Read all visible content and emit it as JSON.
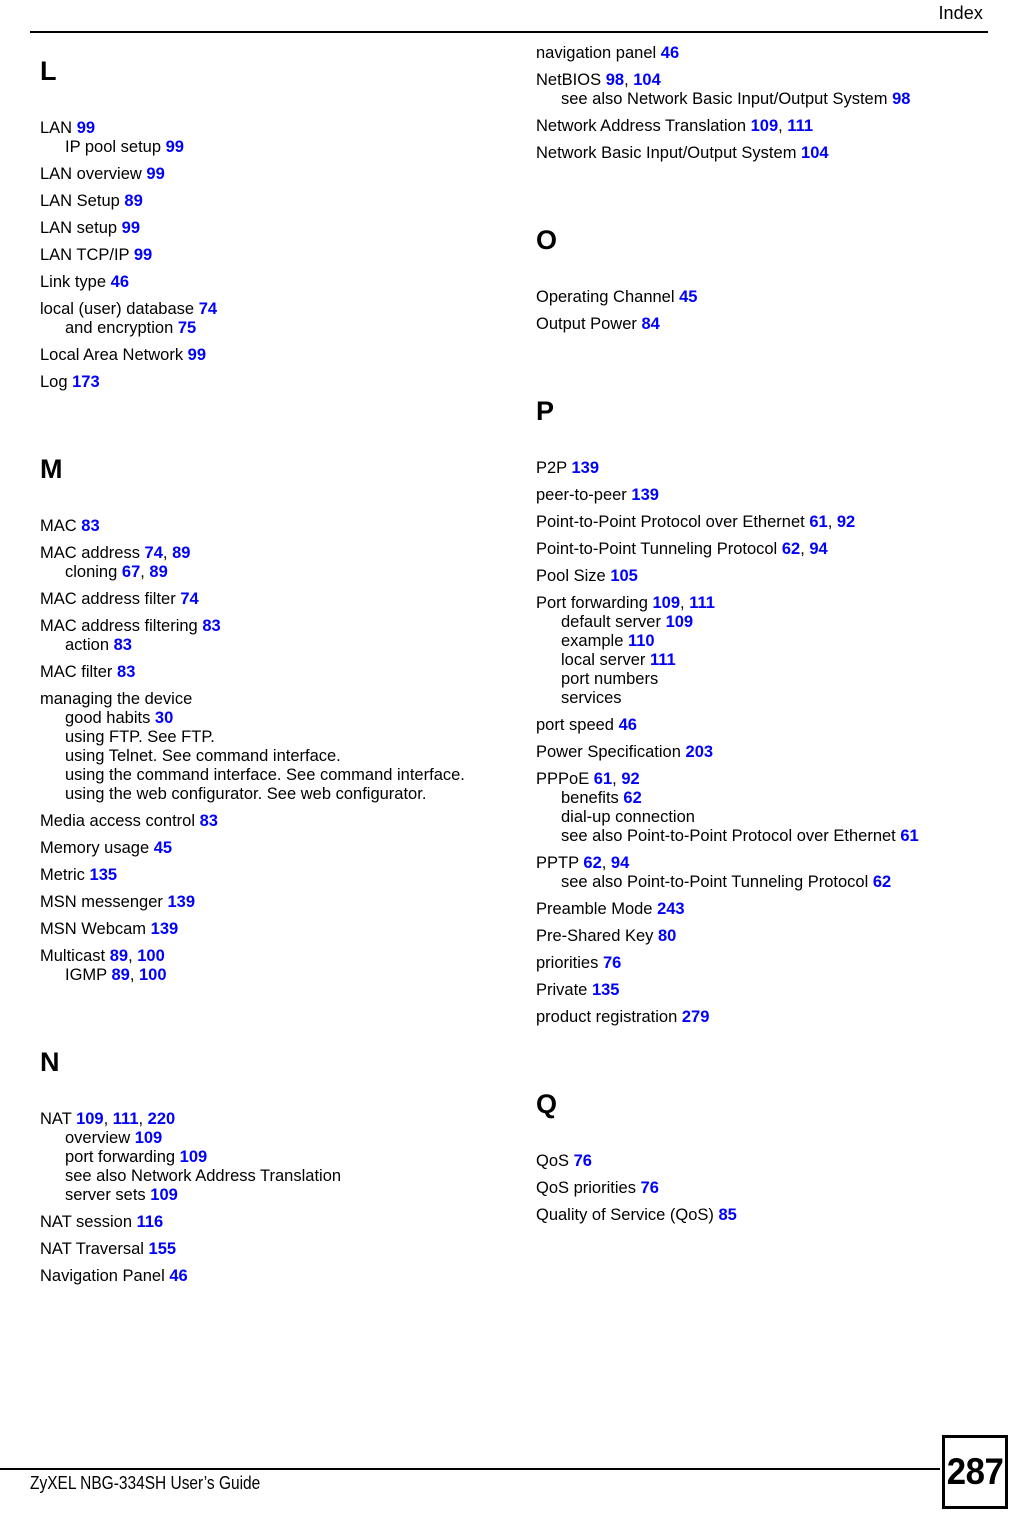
{
  "header": {
    "title": "Index"
  },
  "footer": {
    "guide_title": "ZyXEL NBG-334SH User’s Guide",
    "page_number": "287"
  },
  "colors": {
    "page_ref": "#0000ff",
    "text": "#000000",
    "background": "#ffffff"
  },
  "columns": {
    "left": {
      "sections": [
        {
          "letter": "L",
          "entries": [
            {
              "text": "LAN",
              "pages": [
                "99"
              ],
              "level": 0
            },
            {
              "text": "IP pool setup",
              "pages": [
                "99"
              ],
              "level": 1
            },
            {
              "text": "LAN overview",
              "pages": [
                "99"
              ],
              "level": 0
            },
            {
              "text": "LAN Setup",
              "pages": [
                "89"
              ],
              "level": 0
            },
            {
              "text": "LAN setup",
              "pages": [
                "99"
              ],
              "level": 0
            },
            {
              "text": "LAN TCP/IP",
              "pages": [
                "99"
              ],
              "level": 0
            },
            {
              "text": "Link type",
              "pages": [
                "46"
              ],
              "level": 0
            },
            {
              "text": "local (user) database",
              "pages": [
                "74"
              ],
              "level": 0
            },
            {
              "text": "and encryption",
              "pages": [
                "75"
              ],
              "level": 1
            },
            {
              "text": "Local Area Network",
              "pages": [
                "99"
              ],
              "level": 0
            },
            {
              "text": "Log",
              "pages": [
                "173"
              ],
              "level": 0
            }
          ]
        },
        {
          "letter": "M",
          "entries": [
            {
              "text": "MAC",
              "pages": [
                "83"
              ],
              "level": 0
            },
            {
              "text": "MAC address",
              "pages": [
                "74",
                "89"
              ],
              "level": 0
            },
            {
              "text": "cloning",
              "pages": [
                "67",
                "89"
              ],
              "level": 1
            },
            {
              "text": "MAC address filter",
              "pages": [
                "74"
              ],
              "level": 0
            },
            {
              "text": "MAC address filtering",
              "pages": [
                "83"
              ],
              "level": 0
            },
            {
              "text": "action",
              "pages": [
                "83"
              ],
              "level": 1
            },
            {
              "text": "MAC filter",
              "pages": [
                "83"
              ],
              "level": 0
            },
            {
              "text": "managing the device",
              "pages": [],
              "level": 0
            },
            {
              "text": "good habits",
              "pages": [
                "30"
              ],
              "level": 1
            },
            {
              "text": "using FTP. See FTP.",
              "pages": [],
              "level": 1
            },
            {
              "text": "using Telnet. See command interface.",
              "pages": [],
              "level": 1
            },
            {
              "text": "using the command interface. See command interface.",
              "pages": [],
              "level": 1,
              "wrap": true
            },
            {
              "text": "using the web configurator. See web configurator.",
              "pages": [],
              "level": 1
            },
            {
              "text": "Media access control",
              "pages": [
                "83"
              ],
              "level": 0
            },
            {
              "text": "Memory usage",
              "pages": [
                "45"
              ],
              "level": 0
            },
            {
              "text": "Metric",
              "pages": [
                "135"
              ],
              "level": 0
            },
            {
              "text": "MSN messenger",
              "pages": [
                "139"
              ],
              "level": 0
            },
            {
              "text": "MSN Webcam",
              "pages": [
                "139"
              ],
              "level": 0
            },
            {
              "text": "Multicast",
              "pages": [
                "89",
                "100"
              ],
              "level": 0
            },
            {
              "text": "IGMP",
              "pages": [
                "89",
                "100"
              ],
              "level": 1
            }
          ]
        },
        {
          "letter": "N",
          "entries": [
            {
              "text": "NAT",
              "pages": [
                "109",
                "111",
                "220"
              ],
              "level": 0
            },
            {
              "text": "overview",
              "pages": [
                "109"
              ],
              "level": 1
            },
            {
              "text": "port forwarding",
              "pages": [
                "109"
              ],
              "level": 1
            },
            {
              "text": "see also Network Address Translation",
              "pages": [],
              "level": 1
            },
            {
              "text": "server sets",
              "pages": [
                "109"
              ],
              "level": 1
            },
            {
              "text": "NAT session",
              "pages": [
                "116"
              ],
              "level": 0
            },
            {
              "text": "NAT Traversal",
              "pages": [
                "155"
              ],
              "level": 0
            },
            {
              "text": "Navigation Panel",
              "pages": [
                "46"
              ],
              "level": 0
            }
          ]
        }
      ]
    },
    "right": {
      "sections": [
        {
          "letter": "",
          "entries": [
            {
              "text": "navigation panel",
              "pages": [
                "46"
              ],
              "level": 0
            },
            {
              "text": "NetBIOS",
              "pages": [
                "98",
                "104"
              ],
              "level": 0
            },
            {
              "text": "see also Network Basic Input/Output System",
              "pages": [
                "98"
              ],
              "level": 1
            },
            {
              "text": "Network Address Translation",
              "pages": [
                "109",
                "111"
              ],
              "level": 0
            },
            {
              "text": "Network Basic Input/Output System",
              "pages": [
                "104"
              ],
              "level": 0
            }
          ]
        },
        {
          "letter": "O",
          "entries": [
            {
              "text": "Operating Channel",
              "pages": [
                "45"
              ],
              "level": 0
            },
            {
              "text": "Output Power",
              "pages": [
                "84"
              ],
              "level": 0
            }
          ]
        },
        {
          "letter": "P",
          "entries": [
            {
              "text": "P2P",
              "pages": [
                "139"
              ],
              "level": 0
            },
            {
              "text": "peer-to-peer",
              "pages": [
                "139"
              ],
              "level": 0
            },
            {
              "text": "Point-to-Point Protocol over Ethernet",
              "pages": [
                "61",
                "92"
              ],
              "level": 0
            },
            {
              "text": "Point-to-Point Tunneling Protocol",
              "pages": [
                "62",
                "94"
              ],
              "level": 0
            },
            {
              "text": "Pool Size",
              "pages": [
                "105"
              ],
              "level": 0
            },
            {
              "text": "Port forwarding",
              "pages": [
                "109",
                "111"
              ],
              "level": 0
            },
            {
              "text": "default server",
              "pages": [
                "109"
              ],
              "level": 1
            },
            {
              "text": "example",
              "pages": [
                "110"
              ],
              "level": 1
            },
            {
              "text": "local server",
              "pages": [
                "111"
              ],
              "level": 1
            },
            {
              "text": "port numbers",
              "pages": [],
              "level": 1
            },
            {
              "text": "services",
              "pages": [],
              "level": 1
            },
            {
              "text": "port speed",
              "pages": [
                "46"
              ],
              "level": 0
            },
            {
              "text": "Power Specification",
              "pages": [
                "203"
              ],
              "level": 0
            },
            {
              "text": "PPPoE",
              "pages": [
                "61",
                "92"
              ],
              "level": 0
            },
            {
              "text": "benefits",
              "pages": [
                "62"
              ],
              "level": 1
            },
            {
              "text": "dial-up connection",
              "pages": [],
              "level": 1
            },
            {
              "text": "see also Point-to-Point Protocol over Ethernet",
              "pages": [
                "61"
              ],
              "level": 1
            },
            {
              "text": "PPTP",
              "pages": [
                "62",
                "94"
              ],
              "level": 0
            },
            {
              "text": "see also Point-to-Point Tunneling Protocol",
              "pages": [
                "62"
              ],
              "level": 1
            },
            {
              "text": "Preamble Mode",
              "pages": [
                "243"
              ],
              "level": 0
            },
            {
              "text": "Pre-Shared Key",
              "pages": [
                "80"
              ],
              "level": 0
            },
            {
              "text": "priorities",
              "pages": [
                "76"
              ],
              "level": 0
            },
            {
              "text": "Private",
              "pages": [
                "135"
              ],
              "level": 0
            },
            {
              "text": "product registration",
              "pages": [
                "279"
              ],
              "level": 0
            }
          ]
        },
        {
          "letter": "Q",
          "entries": [
            {
              "text": "QoS",
              "pages": [
                "76"
              ],
              "level": 0
            },
            {
              "text": "QoS priorities",
              "pages": [
                "76"
              ],
              "level": 0
            },
            {
              "text": "Quality of Service (QoS)",
              "pages": [
                "85"
              ],
              "level": 0
            }
          ]
        }
      ]
    }
  }
}
